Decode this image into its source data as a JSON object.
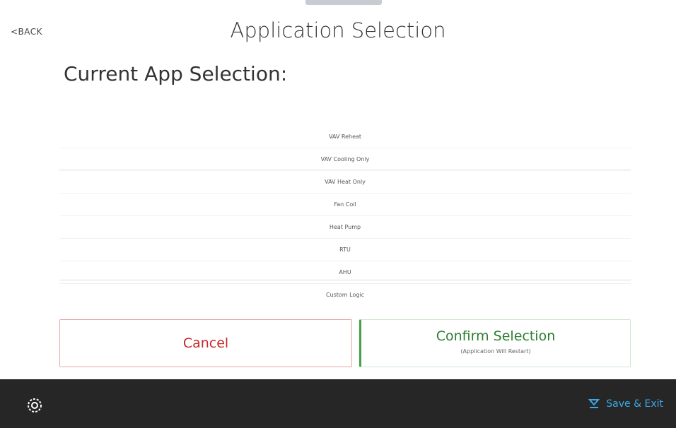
{
  "header": {
    "back_label": "<BACK",
    "title": "Application Selection"
  },
  "section": {
    "title": "Current App Selection:"
  },
  "picker": {
    "items": [
      {
        "label": "VAV Reheat"
      },
      {
        "label": "VAV Cooling Only"
      },
      {
        "label": "VAV Heat Only"
      },
      {
        "label": "Fan Coil"
      },
      {
        "label": "Heat Pump"
      },
      {
        "label": "RTU"
      },
      {
        "label": "AHU"
      },
      {
        "label": "Custom Logic"
      }
    ]
  },
  "actions": {
    "cancel_label": "Cancel",
    "confirm_label": "Confirm Selection",
    "confirm_sublabel": "(Application Will Restart)"
  },
  "bottom_bar": {
    "settings_icon": "settings-gear-icon",
    "save_exit_label": "Save & Exit",
    "save_icon": "save-icon"
  },
  "colors": {
    "cancel": "#c62828",
    "confirm": "#2e7d32",
    "confirm_accent": "#43a047",
    "bar": "#262626",
    "link": "#3aa8e8"
  }
}
